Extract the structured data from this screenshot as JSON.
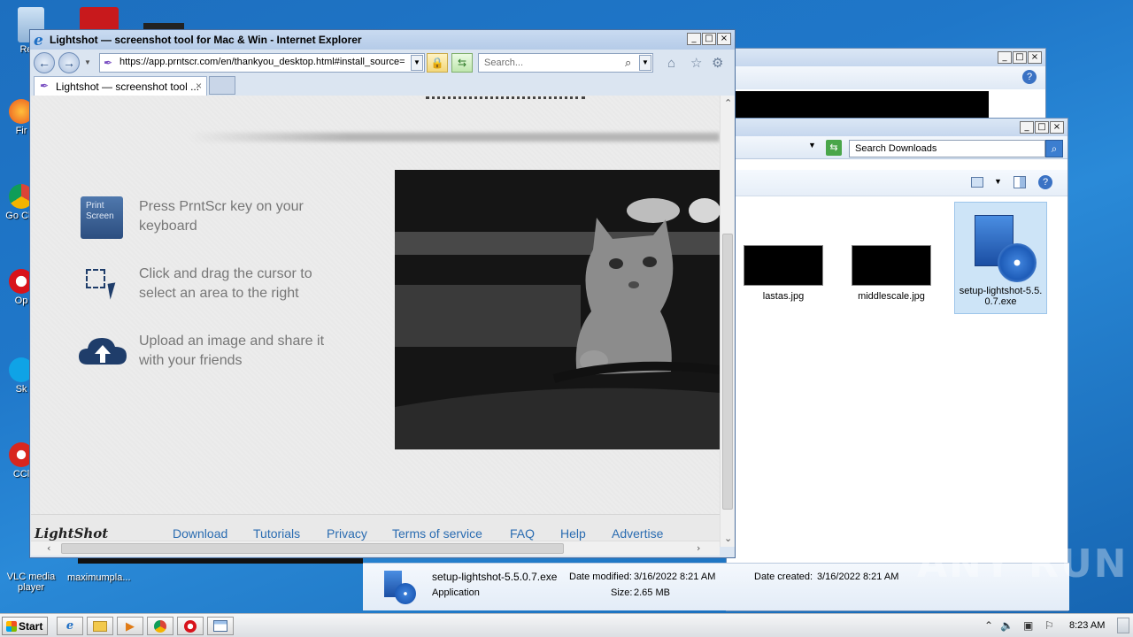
{
  "desktop": {
    "icons": [
      "Recy",
      "Fir",
      "Go Chr",
      "Op",
      "Sk",
      "CCl",
      "VLC media player"
    ],
    "maximumplace_label": "maximumpla..."
  },
  "ie": {
    "window_title": "Lightshot — screenshot tool for Mac & Win - Internet Explorer",
    "url": "https://app.prntscr.com/en/thankyou_desktop.html#install_source=",
    "search_placeholder": "Search...",
    "tab_title": "Lightshot — screenshot tool ...",
    "tab_close": "×"
  },
  "page": {
    "steps": [
      "Press PrntScr key on your keyboard",
      "Click and drag the cursor to select an area to the right",
      "Upload an image and share it with your friends"
    ],
    "print_key_label": "Print Screen",
    "footer": {
      "logo": "LightShot",
      "links": [
        "Download",
        "Tutorials",
        "Privacy",
        "Terms of service",
        "FAQ",
        "Help",
        "Advertise"
      ]
    }
  },
  "explorer": {
    "search_placeholder": "Search Downloads",
    "files": [
      {
        "name": "lastas.jpg"
      },
      {
        "name": "middlescale.jpg"
      },
      {
        "name": "setup-lightshot-5.5.0.7.exe"
      }
    ],
    "details": {
      "filename": "setup-lightshot-5.5.0.7.exe",
      "type": "Application",
      "modified_label": "Date modified:",
      "modified_value": "3/16/2022 8:21 AM",
      "created_label": "Date created:",
      "created_value": "3/16/2022 8:21 AM",
      "size_label": "Size:",
      "size_value": "2.65 MB"
    }
  },
  "taskbar": {
    "start_label": "Start",
    "clock": "8:23 AM"
  },
  "watermark": "ANY RUN"
}
